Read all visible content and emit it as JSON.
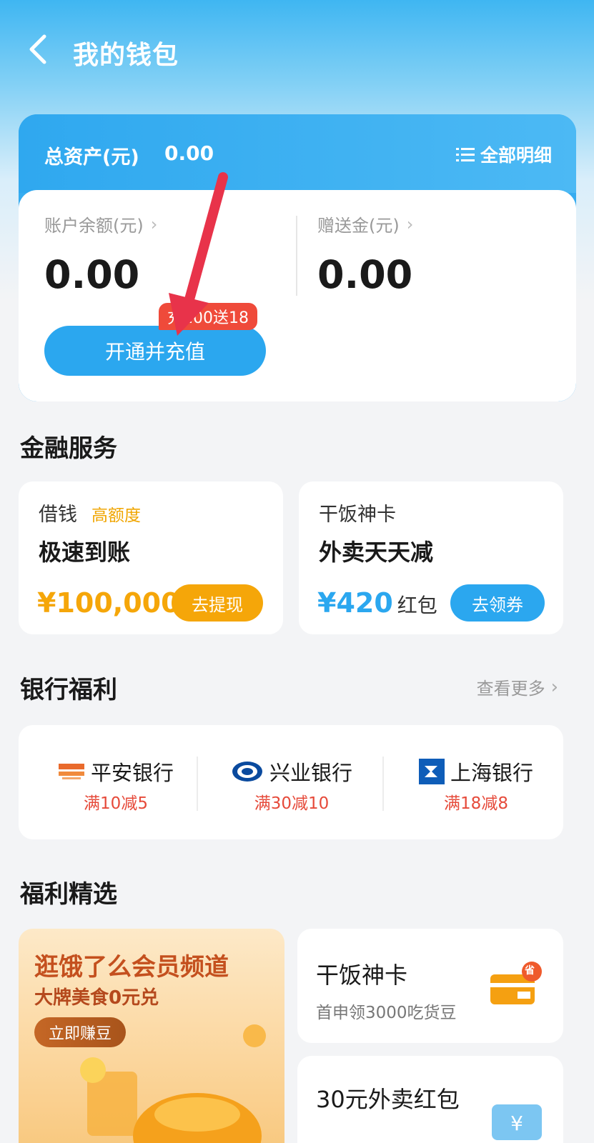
{
  "header": {
    "title": "我的钱包"
  },
  "assets": {
    "total_label": "总资产(元)",
    "total_value": "0.00",
    "detail_label": "全部明细",
    "balance_label": "账户余额(元)",
    "balance_value": "0.00",
    "bonus_label": "赠送金(元)",
    "bonus_value": "0.00",
    "recharge_button": "开通并充值",
    "promo_badge": "充100送18"
  },
  "finance": {
    "section_title": "金融服务",
    "loan": {
      "title": "借钱",
      "tag": "高额度",
      "headline": "极速到账",
      "amount": "¥100,000",
      "button": "去提现"
    },
    "card": {
      "title": "干饭神卡",
      "headline": "外卖天天减",
      "amount": "¥420",
      "unit": "红包",
      "button": "去领券"
    }
  },
  "bank": {
    "section_title": "银行福利",
    "see_more": "查看更多",
    "items": [
      {
        "name": "平安银行",
        "offer": "满10减5"
      },
      {
        "name": "兴业银行",
        "offer": "满30减10"
      },
      {
        "name": "上海银行",
        "offer": "满18减8"
      }
    ]
  },
  "featured": {
    "section_title": "福利精选",
    "big": {
      "title": "逛饿了么会员频道",
      "subtitle": "大牌美食0元兑",
      "button": "立即赚豆"
    },
    "card1": {
      "title": "干饭神卡",
      "subtitle": "首申领3000吃货豆",
      "badge": "省"
    },
    "card2": {
      "title": "30元外卖红包"
    }
  },
  "colors": {
    "primary": "#2ba7ef",
    "orange": "#f5a609",
    "red": "#e64a3a",
    "annotation_arrow": "#e8334a"
  }
}
